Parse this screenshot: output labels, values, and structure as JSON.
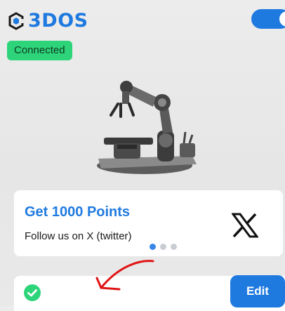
{
  "header": {
    "logo_text": "3DOS",
    "status_label": "Connected",
    "toggle_on": true
  },
  "promo": {
    "title": "Get 1000 Points",
    "subtitle": "Follow us on X (twitter)",
    "carousel": {
      "count": 3,
      "active": 1
    }
  },
  "row": {
    "edit_label": "Edit"
  },
  "colors": {
    "accent": "#1f7ae0",
    "success": "#2ed47a",
    "annotation": "#e01414"
  },
  "icons": [
    "3dos-logo-icon",
    "toggle-switch",
    "robot-arm-illustration",
    "x-logo-icon",
    "check-circle-icon",
    "red-arrow-annotation"
  ]
}
